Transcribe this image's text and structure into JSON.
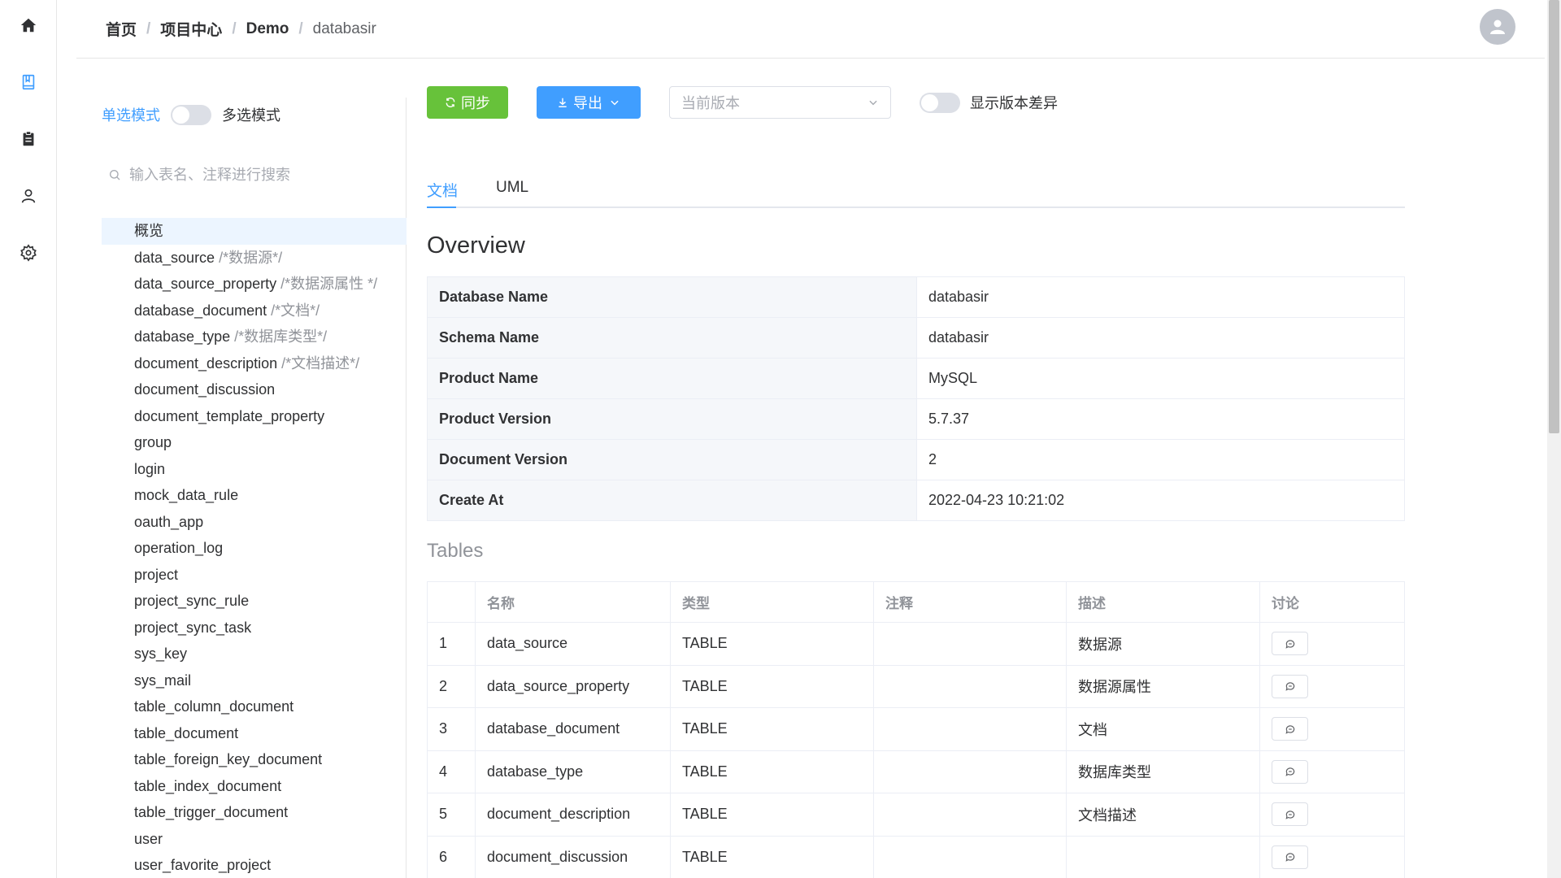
{
  "breadcrumb": [
    "首页",
    "项目中心",
    "Demo",
    "databasir"
  ],
  "sidebar_nav": [
    "home-icon",
    "book-icon",
    "clipboard-icon",
    "user-icon",
    "gear-icon"
  ],
  "mode": {
    "single": "单选模式",
    "multi": "多选模式"
  },
  "search": {
    "placeholder": "输入表名、注释进行搜索"
  },
  "table_list": [
    {
      "name": "概览",
      "comment": ""
    },
    {
      "name": "data_source",
      "comment": " /*数据源*/"
    },
    {
      "name": "data_source_property",
      "comment": " /*数据源属性 */"
    },
    {
      "name": "database_document",
      "comment": " /*文档*/"
    },
    {
      "name": "database_type",
      "comment": " /*数据库类型*/"
    },
    {
      "name": "document_description",
      "comment": " /*文档描述*/"
    },
    {
      "name": "document_discussion",
      "comment": ""
    },
    {
      "name": "document_template_property",
      "comment": ""
    },
    {
      "name": "group",
      "comment": ""
    },
    {
      "name": "login",
      "comment": ""
    },
    {
      "name": "mock_data_rule",
      "comment": ""
    },
    {
      "name": "oauth_app",
      "comment": ""
    },
    {
      "name": "operation_log",
      "comment": ""
    },
    {
      "name": "project",
      "comment": ""
    },
    {
      "name": "project_sync_rule",
      "comment": ""
    },
    {
      "name": "project_sync_task",
      "comment": ""
    },
    {
      "name": "sys_key",
      "comment": ""
    },
    {
      "name": "sys_mail",
      "comment": ""
    },
    {
      "name": "table_column_document",
      "comment": ""
    },
    {
      "name": "table_document",
      "comment": ""
    },
    {
      "name": "table_foreign_key_document",
      "comment": ""
    },
    {
      "name": "table_index_document",
      "comment": ""
    },
    {
      "name": "table_trigger_document",
      "comment": ""
    },
    {
      "name": "user",
      "comment": ""
    },
    {
      "name": "user_favorite_project",
      "comment": ""
    }
  ],
  "toolbar": {
    "sync_label": "同步",
    "export_label": "导出",
    "version_placeholder": "当前版本",
    "diff_label": "显示版本差异"
  },
  "tabs": [
    "文档",
    "UML"
  ],
  "overview": {
    "title": "Overview",
    "rows": [
      [
        "Database Name",
        "databasir"
      ],
      [
        "Schema Name",
        "databasir"
      ],
      [
        "Product Name",
        "MySQL"
      ],
      [
        "Product Version",
        "5.7.37"
      ],
      [
        "Document Version",
        "2"
      ],
      [
        "Create At",
        "2022-04-23 10:21:02"
      ]
    ]
  },
  "tables": {
    "title": "Tables",
    "headers": [
      "",
      "名称",
      "类型",
      "注释",
      "描述",
      "讨论"
    ],
    "rows": [
      [
        "1",
        "data_source",
        "TABLE",
        "",
        "数据源"
      ],
      [
        "2",
        "data_source_property",
        "TABLE",
        "",
        "数据源属性"
      ],
      [
        "3",
        "database_document",
        "TABLE",
        "",
        "文档"
      ],
      [
        "4",
        "database_type",
        "TABLE",
        "",
        "数据库类型"
      ],
      [
        "5",
        "document_description",
        "TABLE",
        "",
        "文档描述"
      ],
      [
        "6",
        "document_discussion",
        "TABLE",
        "",
        ""
      ]
    ]
  },
  "colors": {
    "primary": "#409eff",
    "success": "#67c23a",
    "border": "#ebeef5"
  }
}
